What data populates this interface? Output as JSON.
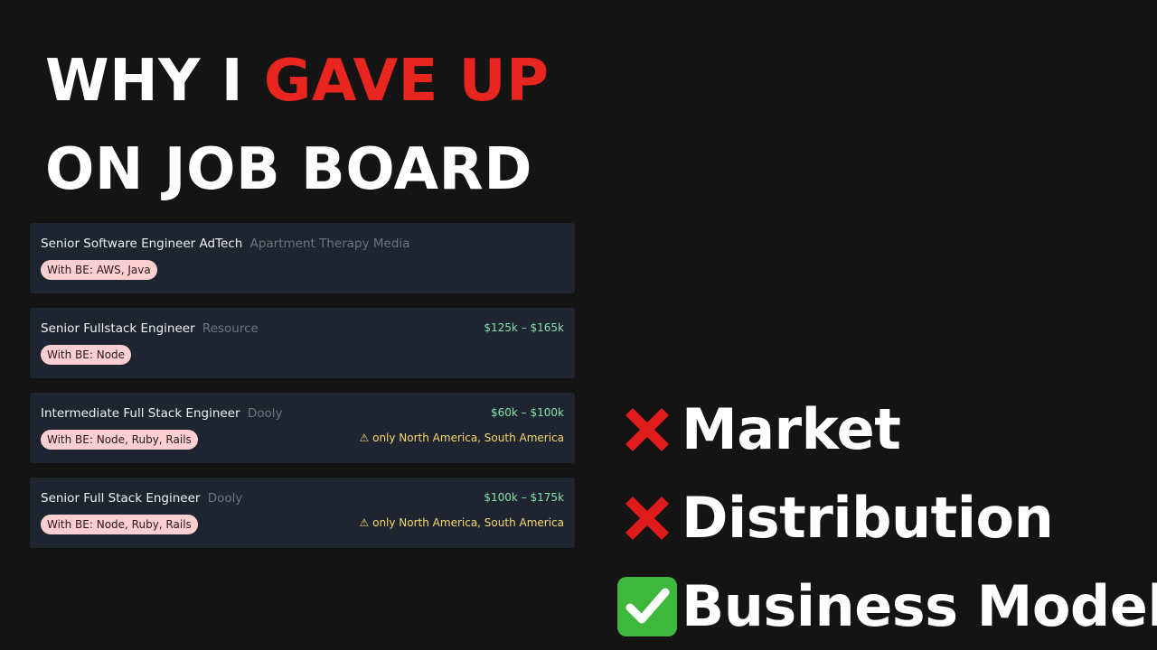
{
  "title": {
    "line1_white": "WHY I ",
    "line1_red": "GAVE UP",
    "line2": "ON JOB BOARD"
  },
  "jobs": [
    {
      "title": "Senior Software Engineer AdTech",
      "company": "Apartment Therapy Media",
      "tag": "With BE: AWS, Java",
      "salary": "",
      "region": ""
    },
    {
      "title": "Senior Fullstack Engineer",
      "company": "Resource",
      "tag": "With BE: Node",
      "salary": "$125k – $165k",
      "region": ""
    },
    {
      "title": "Intermediate Full Stack Engineer",
      "company": "Dooly",
      "tag": "With BE: Node, Ruby, Rails",
      "salary": "$60k – $100k",
      "region": "⚠ only North America, South America"
    },
    {
      "title": "Senior Full Stack Engineer",
      "company": "Dooly",
      "tag": "With BE: Node, Ruby, Rails",
      "salary": "$100k – $175k",
      "region": "⚠ only North America, South America"
    }
  ],
  "checklist": [
    {
      "icon": "cross-mark-icon",
      "label": "Market",
      "status": "fail"
    },
    {
      "icon": "cross-mark-icon",
      "label": "Distribution",
      "status": "fail"
    },
    {
      "icon": "check-mark-icon",
      "label": "Business Model",
      "status": "pass"
    }
  ],
  "colors": {
    "background": "#141414",
    "accent_red": "#e8261f",
    "card": "#1f2530",
    "tag": "#fbcfd0",
    "salary": "#86e0a8",
    "region": "#f5d86a",
    "check_green": "#3db83d"
  }
}
